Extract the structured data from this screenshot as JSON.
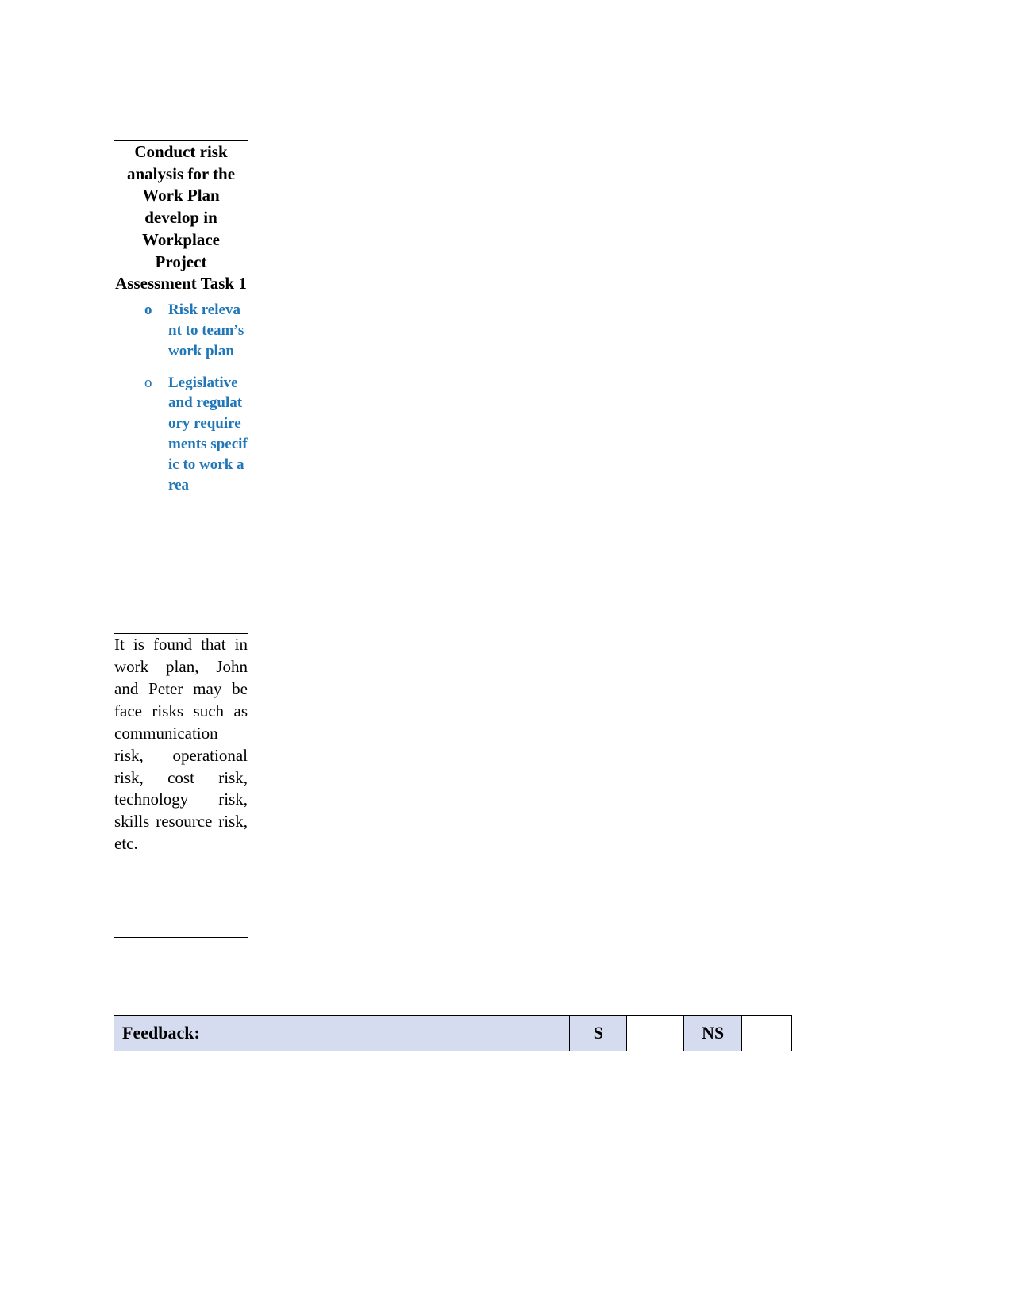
{
  "document": {
    "heading": "Conduct risk analysis for the Work Plan develop in Workplace Project Assessment Task 1",
    "bullets": [
      {
        "marker": "o",
        "text": "Risk relevant to team’s work plan"
      },
      {
        "marker": "o",
        "text": "Legislative and regulatory requirements specific to work area"
      }
    ],
    "body_paragraph": "It is found that in work plan, John and Peter may be face risks such as communication risk, operational risk, cost risk, technology risk, skills resource risk, etc."
  },
  "feedback_row": {
    "label": "Feedback:",
    "satisfactory_label": "S",
    "satisfactory_value": "",
    "not_satisfactory_label": "NS",
    "not_satisfactory_value": ""
  },
  "bottom_cell": {
    "value": ""
  },
  "colors": {
    "bullet_blue": "#1F76B8",
    "feedback_fill": "#D5DCF0",
    "border": "#000000",
    "text": "#000000"
  }
}
